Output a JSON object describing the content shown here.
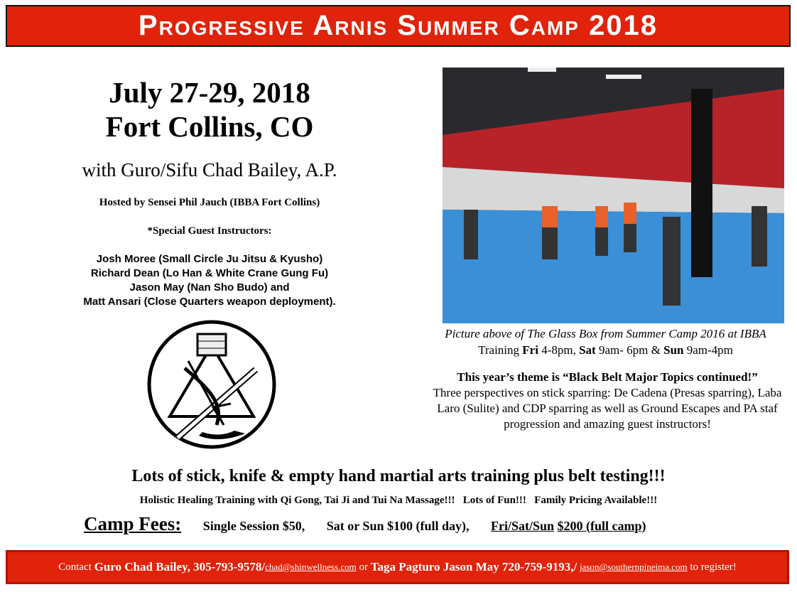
{
  "header": {
    "title": "Progressive Arnis Summer Camp 2018"
  },
  "event": {
    "dates": "July 27-29, 2018",
    "location": "Fort Collins, CO",
    "with": "with Guro/Sifu Chad Bailey, A.P.",
    "hosted": "Hosted by Sensei Phil Jauch (IBBA Fort Collins)",
    "special": "*Special Guest Instructors:",
    "instructors": [
      "Josh Moree (Small Circle Ju Jitsu & Kyusho)",
      "Richard Dean (Lo Han & White Crane Gung Fu)",
      "Jason May (Nan Sho Budo) and",
      "Matt Ansari (Close Quarters weapon deployment)."
    ]
  },
  "photo": {
    "caption": "Picture above of The Glass Box from Summer Camp 2016 at IBBA"
  },
  "training": {
    "label": "Training",
    "fri": "Fri",
    "fri_time": "4-8pm,",
    "sat": "Sat",
    "sat_time": "9am- 6pm &",
    "sun": "Sun",
    "sun_time": "9am-4pm"
  },
  "theme": {
    "title": "This year’s theme is “Black Belt Major Topics continued!”",
    "lines": [
      "Three perspectives on stick sparring: De Cadena (Presas sparring), Laba",
      "Laro (Sulite) and CDP sparring as well as Ground Escapes and PA staf",
      "progression and amazing guest instructors!"
    ]
  },
  "highlights": {
    "main": "Lots of stick, knife & empty hand martial arts training plus belt testing!!!",
    "sub": "Holistic Healing Training with Qi Gong, Tai Ji and Tui Na Massage!!!   Lots of Fun!!!   Family Pricing Available!!!"
  },
  "fees": {
    "label": "Camp Fees:",
    "single": "Single Session $50,",
    "day": "Sat or Sun $100 (full day),",
    "full_days": "Fri/Sat/Sun",
    "full_price": "$200 (full camp)"
  },
  "footer": {
    "contact": "Contact",
    "person1": "Guro Chad Bailey, 305-793-9578/",
    "email1": "chad@shinwellness.com",
    "or": "or",
    "person2": "Taga Pagturo Jason May 720-759-9193,/",
    "email2": "jason@southernpineima.com",
    "end": "to register!"
  }
}
